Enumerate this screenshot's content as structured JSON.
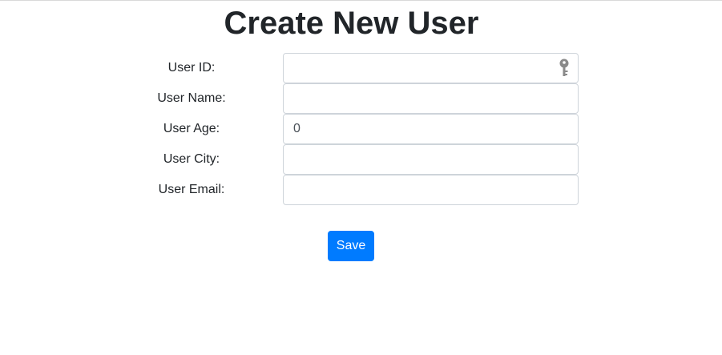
{
  "page": {
    "title": "Create New User"
  },
  "form": {
    "fields": [
      {
        "label": "User ID:",
        "value": "",
        "placeholder": ""
      },
      {
        "label": "User Name:",
        "value": "",
        "placeholder": ""
      },
      {
        "label": "User Age:",
        "value": "0",
        "placeholder": ""
      },
      {
        "label": "User City:",
        "value": "",
        "placeholder": ""
      },
      {
        "label": "User Email:",
        "value": "",
        "placeholder": ""
      }
    ],
    "save_label": "Save"
  },
  "icons": {
    "user_id_field_icon": "key-icon"
  },
  "colors": {
    "primary_button": "#007bff",
    "input_border": "#ced4da",
    "text": "#212529"
  }
}
